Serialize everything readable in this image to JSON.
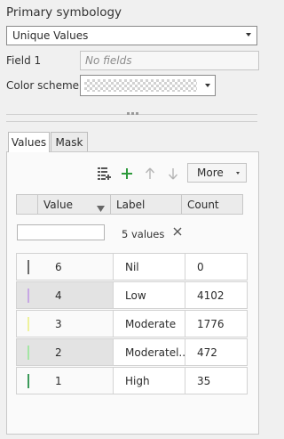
{
  "section_title": "Primary symbology",
  "primary_symbology": {
    "selected": "Unique Values"
  },
  "field1": {
    "label": "Field 1",
    "value": "No fields"
  },
  "color_scheme": {
    "label": "Color scheme"
  },
  "tabs": [
    {
      "label": "Values"
    },
    {
      "label": "Mask"
    }
  ],
  "toolbar": {
    "more_label": "More"
  },
  "grid": {
    "headers": {
      "value": "Value",
      "label": "Label",
      "count": "Count"
    },
    "values_count": "5 values",
    "rows": [
      {
        "value": "6",
        "label": "Nil",
        "count": "0",
        "color": "#6b6b6b"
      },
      {
        "value": "4",
        "label": "Low",
        "count": "4102",
        "color": "#c7a7e4"
      },
      {
        "value": "3",
        "label": "Moderate",
        "count": "1776",
        "color": "#eef29c"
      },
      {
        "value": "2",
        "label": "Moderatel...",
        "count": "472",
        "color": "#a4e6a4"
      },
      {
        "value": "1",
        "label": "High",
        "count": "35",
        "color": "#3c9a5a"
      }
    ]
  },
  "colors": {
    "add_icon": "#2e9a3c"
  }
}
